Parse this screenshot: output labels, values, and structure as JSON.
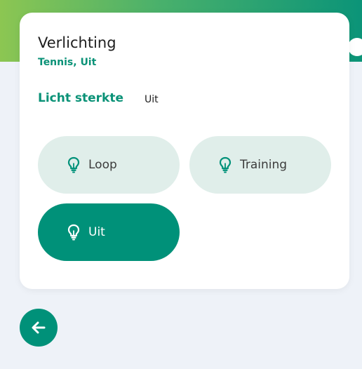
{
  "card": {
    "title": "Verlichting",
    "subtitle": "Tennis, Uit",
    "strength_label": "Licht sterkte",
    "strength_value": "Uit"
  },
  "modes": [
    {
      "label": "Loop",
      "icon": "lightbulb-icon",
      "selected": false
    },
    {
      "label": "Training",
      "icon": "lightbulb-icon",
      "selected": false
    },
    {
      "label": "Uit",
      "icon": "lightbulb-icon",
      "selected": true
    }
  ],
  "back_button": {
    "icon": "arrow-left-icon"
  },
  "colors": {
    "accent": "#009179",
    "inactive_button": "#e0eeea",
    "gradient_start": "#8cc652",
    "gradient_end": "#0b9478",
    "background": "#eef2f8"
  }
}
